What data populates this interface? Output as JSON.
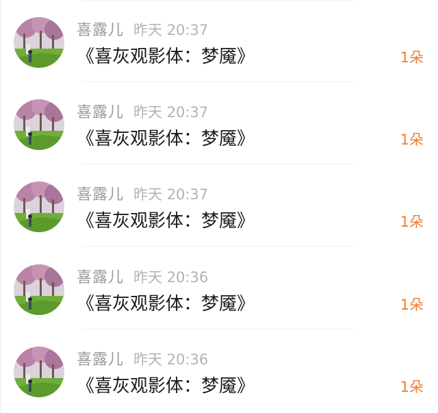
{
  "messages": [
    {
      "user": "喜露儿",
      "time": "昨天 20:37",
      "title": "《喜灰观影体：梦魇》",
      "count": "1朵"
    },
    {
      "user": "喜露儿",
      "time": "昨天 20:37",
      "title": "《喜灰观影体：梦魇》",
      "count": "1朵"
    },
    {
      "user": "喜露儿",
      "time": "昨天 20:37",
      "title": "《喜灰观影体：梦魇》",
      "count": "1朵"
    },
    {
      "user": "喜露儿",
      "time": "昨天 20:36",
      "title": "《喜灰观影体：梦魇》",
      "count": "1朵"
    },
    {
      "user": "喜露儿",
      "time": "昨天 20:36",
      "title": "《喜灰观影体：梦魇》",
      "count": "1朵"
    }
  ],
  "colors": {
    "username": "#9a9a9a",
    "timestamp": "#b3b3b3",
    "title": "#1a1a1a",
    "count_accent": "#f07c2f",
    "avatar_sky": "#d7ccd6",
    "avatar_tree_blossom": "#b982a6",
    "avatar_grass": "#6fae3a"
  },
  "icons": {
    "avatar": "avatar-photo-blossom-trees"
  }
}
